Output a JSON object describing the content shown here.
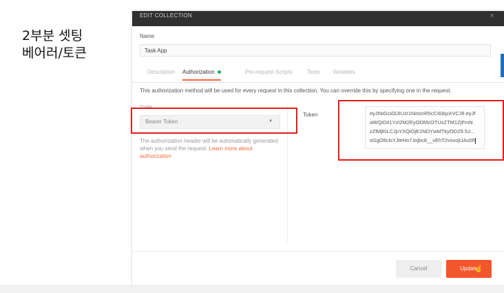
{
  "annotation": "2부분 셋팅\n베어러/토큰",
  "modal": {
    "title": "EDIT COLLECTION",
    "close_label": "×",
    "name_label": "Name",
    "name_value": "Task App",
    "tabs": [
      {
        "label": "Description",
        "active": false
      },
      {
        "label": "Authorization",
        "active": true,
        "indicator_color": "#27ae60"
      },
      {
        "label": "Pre-request Scripts",
        "active": false
      },
      {
        "label": "Tests",
        "active": false
      },
      {
        "label": "Variables",
        "active": false
      }
    ],
    "info_text": "This authorization method will be used for every request in this collection. You can override this by specifying one in the request.",
    "type_label": "TYPE",
    "type_selected": "Bearer Token",
    "helper_text": "The authorization header will be automatically generated when you send the request.",
    "helper_link": "Learn more about authorization",
    "token_label": "Token",
    "token_lines": [
      "eyJhbGciOiJIUzI1NiIsInR5cCI6IkpXVCJ9.eyJf",
      "aWQiOiI1YzI2M2EyODMzOTUxZTM1ZjFmN",
      "zZlMjEiLCJpYXQiOjE1NDYwMTkyODZ9.5J...",
      "xGgO6clsYJleHo7Jojbc8__vEhT2vsvojUAu5fI"
    ],
    "cancel_label": "Cancel",
    "update_label": "Update"
  },
  "colors": {
    "accent": "#f26b3a",
    "primary_button": "#f2562b",
    "highlight": "#e41a1a",
    "header_bg": "#303030"
  }
}
